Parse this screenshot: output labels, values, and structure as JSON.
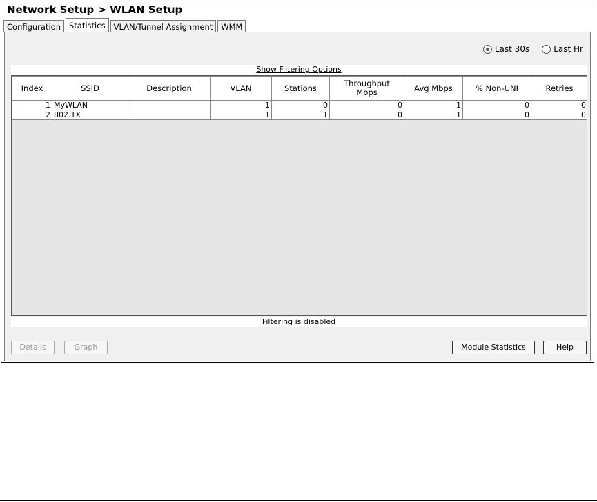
{
  "window": {
    "title": "Network Setup > WLAN Setup"
  },
  "tabs": [
    {
      "label": "Configuration"
    },
    {
      "label": "Statistics"
    },
    {
      "label": "VLAN/Tunnel Assignment"
    },
    {
      "label": "WMM"
    }
  ],
  "active_tab": "Statistics",
  "time_range": {
    "options": [
      {
        "label": "Last 30s",
        "selected": true
      },
      {
        "label": "Last Hr",
        "selected": false
      }
    ]
  },
  "filter": {
    "link_label": "Show Filtering Options",
    "status_text": "Filtering is disabled"
  },
  "table": {
    "columns": [
      "Index",
      "SSID",
      "Description",
      "VLAN",
      "Stations",
      "Throughput Mbps",
      "Avg Mbps",
      "% Non-UNI",
      "Retries"
    ],
    "rows": [
      [
        "1",
        "MyWLAN",
        "",
        "1",
        "0",
        "0",
        "1",
        "0",
        "0"
      ],
      [
        "2",
        "802.1X",
        "",
        "1",
        "1",
        "0",
        "1",
        "0",
        "0"
      ]
    ]
  },
  "buttons": {
    "details": "Details",
    "graph": "Graph",
    "module_statistics": "Module Statistics",
    "help": "Help"
  }
}
